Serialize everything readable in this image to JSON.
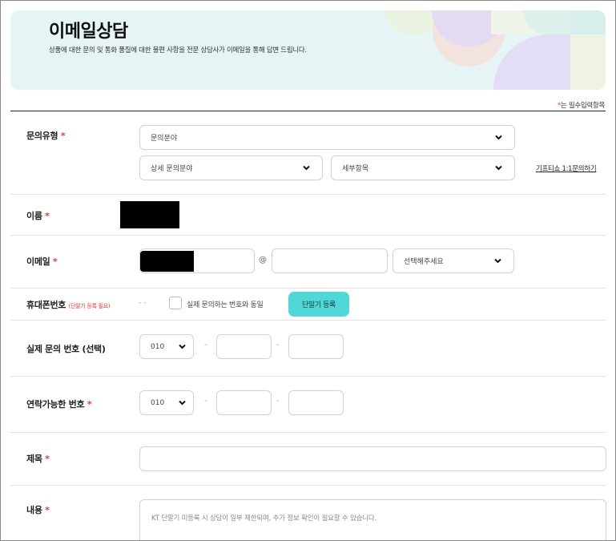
{
  "banner": {
    "title": "이메일상담",
    "description": "상품에 대한 문의 및 통화 품질에 대한 불편 사항을 전문 상담사가 이메일을 통해 답변 드립니다."
  },
  "required_note": {
    "star": "*",
    "text": "는 필수입력항목"
  },
  "inquiry_type": {
    "label": "문의유형",
    "category_select": "문의분야",
    "detail_select": "상세 문의분야",
    "item_select": "세부항목",
    "gift_link": "기프티쇼 1:1문의하기"
  },
  "name": {
    "label": "이름"
  },
  "email": {
    "label": "이메일",
    "at": "@",
    "domain_value": "",
    "domain_select": "선택해주세요"
  },
  "mobile": {
    "label": "휴대폰번호",
    "sub": "(단말기 등록 필요)",
    "value": "- -",
    "same_checkbox_label": "실제 문의하는 번호와 동일",
    "register_button": "단말기 등록"
  },
  "actual_number": {
    "label": "실제 문의 번호 (선택)",
    "prefix": "010",
    "sep": "-"
  },
  "contact_number": {
    "label": "연락가능한 번호",
    "prefix": "010",
    "sep": "-"
  },
  "subject": {
    "label": "제목",
    "value": ""
  },
  "content": {
    "label": "내용",
    "placeholder": "KT 단말기 미등록 시 상담이 일부 제한되며, 추가 정보 확인이 필요할 수 있습니다."
  },
  "colors": {
    "required_star": "#e53935",
    "register_button": "#4fd8d7",
    "banner_bg": "#e6f4f6"
  }
}
